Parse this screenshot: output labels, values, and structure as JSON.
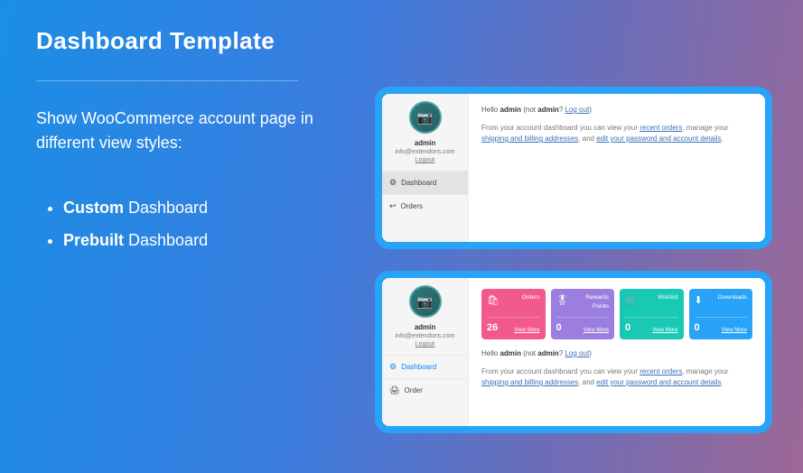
{
  "title": "Dashboard Template",
  "subtitle": "Show WooCommerce account page in different view styles:",
  "bullets": [
    {
      "strong": "Custom",
      "rest": " Dashboard"
    },
    {
      "strong": "Prebuilt",
      "rest": " Dashboard"
    }
  ],
  "sidebar": {
    "name": "admin",
    "email": "info@extendons.com",
    "logout": "Logout",
    "items": [
      {
        "icon": "⚙",
        "label": "Dashboard"
      },
      {
        "icon": "↩",
        "label": "Orders"
      }
    ],
    "items2": [
      {
        "icon": "⚙",
        "label": "Dashboard"
      },
      {
        "icon": "🖨",
        "label": "Order"
      }
    ]
  },
  "hello": {
    "prefix": "Hello ",
    "name": "admin",
    "mid": " (not ",
    "name2": "admin",
    "q": "? ",
    "logout": "Log out",
    "suffix": ")"
  },
  "dash_text": {
    "p1": "From your account dashboard you can view your ",
    "link1": "recent orders",
    "p2": ", manage your ",
    "link2": "shipping and billing addresses",
    "p3": ", and ",
    "link3": "edit your password and account details",
    "p4": "."
  },
  "cards": [
    {
      "label": "Orders",
      "count": "26",
      "view": "View More",
      "cls": "c-pink",
      "icon": "🛍"
    },
    {
      "label": "Rewards Points",
      "count": "0",
      "view": "View More",
      "cls": "c-purple",
      "icon": "🎖"
    },
    {
      "label": "Wishlist",
      "count": "0",
      "view": "View More",
      "cls": "c-teal",
      "icon": "🛒"
    },
    {
      "label": "Downloads",
      "count": "0",
      "view": "View More",
      "cls": "c-blue",
      "icon": "⬇"
    }
  ]
}
